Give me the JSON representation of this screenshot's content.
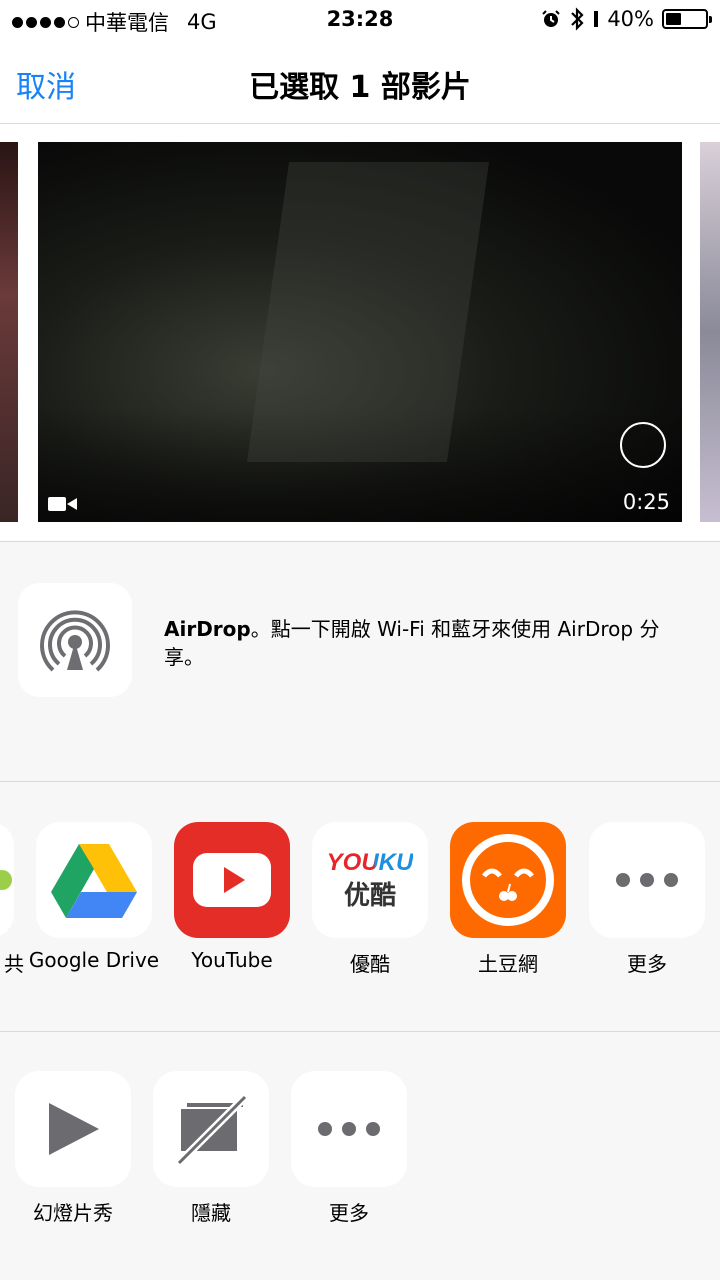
{
  "status_bar": {
    "carrier": "中華電信",
    "network": "4G",
    "time": "23:28",
    "battery": "40%",
    "battery_level": 0.4
  },
  "nav": {
    "cancel_label": "取消",
    "title": "已選取 1 部影片"
  },
  "photo": {
    "duration": "0:25"
  },
  "airdrop": {
    "title": "AirDrop",
    "message": "。點一下開啟 Wi-Fi 和藍牙來使用 AirDrop 分享。"
  },
  "share_apps": {
    "partial_label": "共",
    "items": [
      {
        "label": "Google Drive",
        "icon": "google-drive-icon"
      },
      {
        "label": "YouTube",
        "icon": "youtube-icon"
      },
      {
        "label": "優酷",
        "icon": "youku-icon",
        "logo_en": "YOUKU",
        "logo_zh": "优酷"
      },
      {
        "label": "土豆網",
        "icon": "tudou-icon"
      },
      {
        "label": "更多",
        "icon": "more-icon"
      }
    ]
  },
  "actions": {
    "items": [
      {
        "label": "幻燈片秀",
        "icon": "play-icon"
      },
      {
        "label": "隱藏",
        "icon": "hide-icon"
      },
      {
        "label": "更多",
        "icon": "more-icon"
      }
    ]
  },
  "colors": {
    "accent": "#1a82f7",
    "youtube_red": "#e52d27",
    "tudou_orange": "#ff6a00"
  }
}
